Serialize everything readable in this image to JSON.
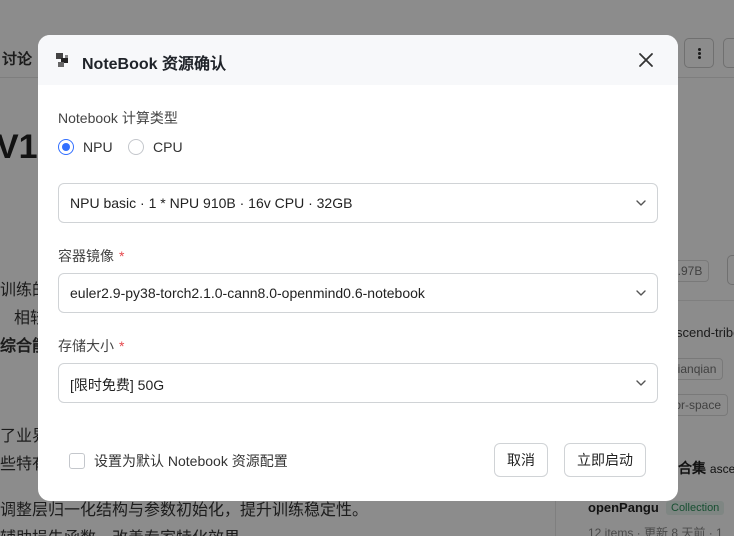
{
  "background": {
    "tab": "讨论",
    "title": "V1",
    "lines": [
      {
        "text": "训练的",
        "bold": false
      },
      {
        "text": "相较",
        "bold": false
      },
      {
        "text": "综合能",
        "bold": true
      },
      {
        "text": "了业界",
        "bold": false
      },
      {
        "text": "些特有",
        "bold": false
      },
      {
        "text": "调整层归一化结构与参数初始化，提升训练稳定性。",
        "bold": false
      },
      {
        "text": "辅助损失函数，改善专家特化效果。",
        "bold": false
      }
    ],
    "sidebar": {
      "size_chip": "3.97B",
      "tag_1": "scend-tribe",
      "tag_2": "qianqian",
      "tag_3": "tor-space",
      "collection_heading": "合集",
      "collection_heading_suffix": "asce",
      "collection_name": "openPangu",
      "collection_badge": "Collection",
      "collection_meta": "12 items · 更新 8 天前 · 1"
    }
  },
  "dialog": {
    "title": "NoteBook 资源确认",
    "compute_type_label": "Notebook 计算类型",
    "radio_options": [
      {
        "label": "NPU",
        "checked": true
      },
      {
        "label": "CPU",
        "checked": false
      }
    ],
    "spec_select": "NPU basic · 1 * NPU 910B · 16v CPU · 32GB",
    "image_label": "容器镜像",
    "image_select": "euler2.9-py38-torch2.1.0-cann8.0-openmind0.6-notebook",
    "storage_label": "存储大小",
    "storage_select": "[限时免费] 50G",
    "required_mark": "*",
    "default_checkbox_label": "设置为默认 Notebook 资源配置",
    "cancel_label": "取消",
    "start_label": "立即启动"
  },
  "colors": {
    "accent": "#3370ff",
    "required": "#e5484d",
    "overlay": "rgba(0,0,0,0.45)"
  }
}
